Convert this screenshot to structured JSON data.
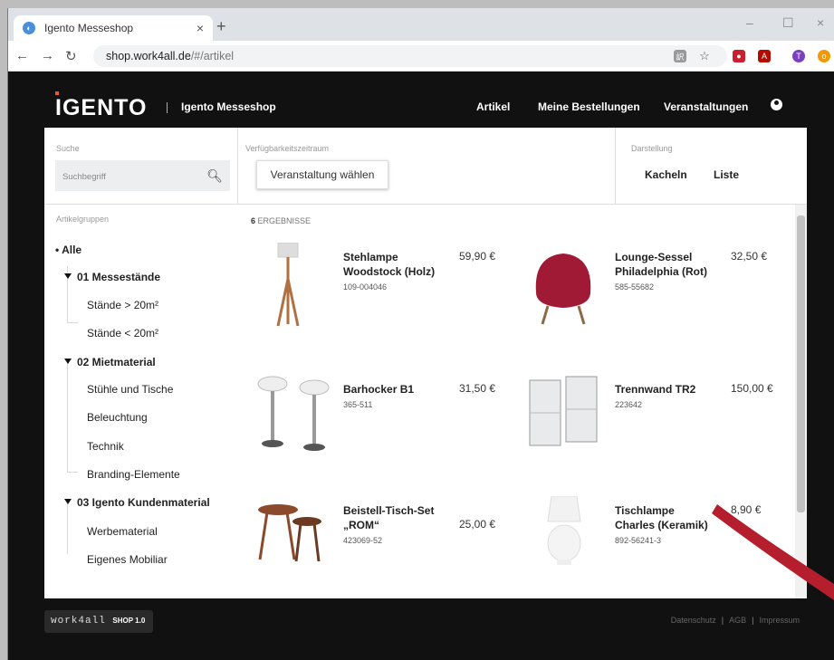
{
  "browser": {
    "tab_title": "Igento Messeshop",
    "url_host": "shop.work4all.de",
    "url_path": "/#/artikel",
    "new_tab": "+",
    "tab_close": "×",
    "window_minimize": "–",
    "window_maximize": "☐",
    "window_close": "×"
  },
  "header": {
    "logo": "IGENTO",
    "shop_name": "Igento Messeshop",
    "nav": [
      "Artikel",
      "Meine Bestellungen",
      "Veranstaltungen"
    ]
  },
  "filters": {
    "search_label": "Suche",
    "search_placeholder": "Suchbegriff",
    "period_label": "Verfügbarkeitszeitraum",
    "period_button": "Veranstaltung wählen",
    "view_label": "Darstellung",
    "view_options": [
      "Kacheln",
      "Liste"
    ]
  },
  "sidebar": {
    "title": "Artikelgruppen",
    "all": "Alle",
    "groups": [
      {
        "name": "01 Messestände",
        "items": [
          "Stände > 20m²",
          "Stände < 20m²"
        ]
      },
      {
        "name": "02 Mietmaterial",
        "items": [
          "Stühle und Tische",
          "Beleuchtung",
          "Technik",
          "Branding-Elemente"
        ]
      },
      {
        "name": "03 Igento Kundenmaterial",
        "items": [
          "Werbematerial",
          "Eigenes Mobiliar"
        ]
      }
    ]
  },
  "results": {
    "count": "6",
    "count_label": "ERGEBNISSE",
    "products": [
      {
        "name": "Stehlampe Woodstock (Holz)",
        "sku": "109-004046",
        "price": "59,90 €"
      },
      {
        "name": "Lounge-Sessel Philadelphia (Rot)",
        "sku": "585-55682",
        "price": "32,50 €"
      },
      {
        "name": "Barhocker B1",
        "sku": "365-511",
        "price": "31,50 €"
      },
      {
        "name": "Trennwand TR2",
        "sku": "223642",
        "price": "150,00 €"
      },
      {
        "name": "Beistell-Tisch-Set „ROM“",
        "sku": "423069-52",
        "price": "25,00 €"
      },
      {
        "name": "Tischlampe Charles (Keramik)",
        "sku": "892-56241-3",
        "price": "8,90 €"
      }
    ]
  },
  "footer": {
    "badge_text": "work4all",
    "badge_version": "SHOP 1.0",
    "links": [
      "Datenschutz",
      "AGB",
      "Impressum"
    ]
  },
  "colors": {
    "header_bg": "#111111",
    "accent": "#e85c2a",
    "swoosh": "#b51e2c"
  }
}
